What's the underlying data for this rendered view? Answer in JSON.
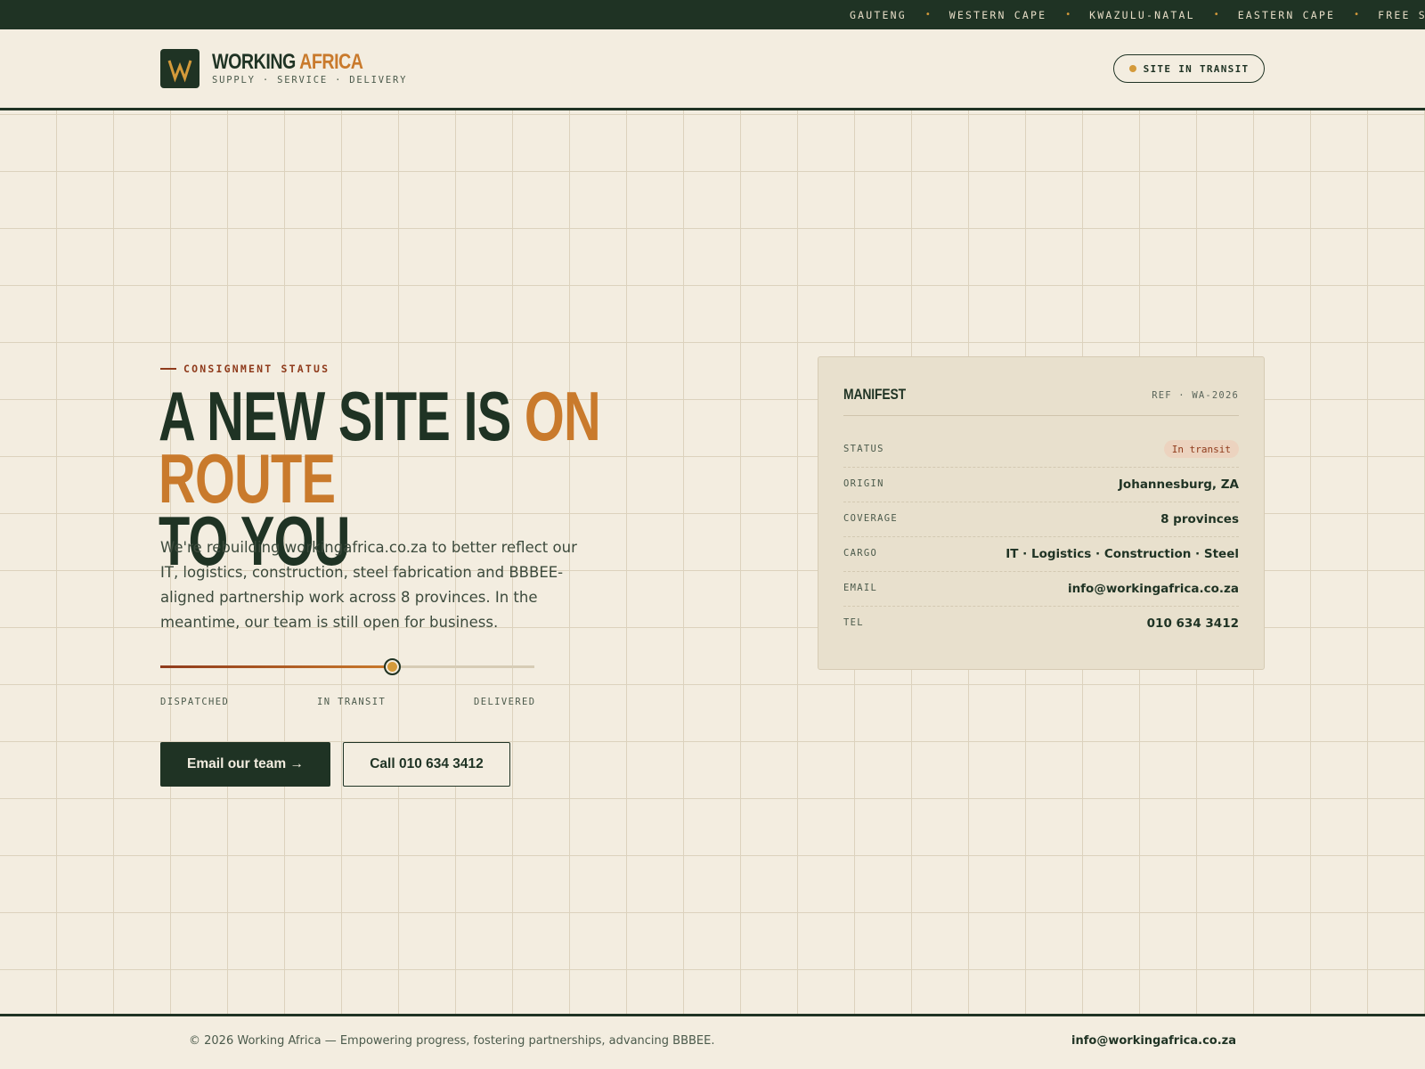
{
  "ticker": {
    "items": [
      "GAUTENG",
      "WESTERN CAPE",
      "KWAZULU-NATAL",
      "EASTERN CAPE",
      "FREE STA"
    ]
  },
  "header": {
    "logo_letter": "W",
    "brand_primary": "WORKING",
    "brand_accent": "AFRICA",
    "tagline": "SUPPLY · SERVICE · DELIVERY",
    "status_pill": "SITE IN TRANSIT"
  },
  "hero": {
    "eyebrow": "CONSIGNMENT STATUS",
    "headline_part1": "A NEW SITE IS ",
    "headline_accent": "ON ROUTE",
    "headline_part2": "TO YOU",
    "lede": "We're rebuilding workingafrica.co.za to better reflect our IT, logistics, construction, steel fabrication and BBBEE-aligned partnership work across 8 provinces. In the meantime, our team is still open for business.",
    "progress_fraction": 0.62,
    "stages": [
      "DISPATCHED",
      "IN TRANSIT",
      "DELIVERED"
    ],
    "primary_button": "Email our team →",
    "secondary_button": "Call 010 634 3412"
  },
  "manifest": {
    "title": "MANIFEST",
    "ref": "REF · WA-2026",
    "rows": [
      {
        "label": "STATUS",
        "value": "In transit"
      },
      {
        "label": "ORIGIN",
        "value": "Johannesburg, ZA"
      },
      {
        "label": "COVERAGE",
        "value": "8 provinces"
      },
      {
        "label": "CARGO",
        "value": "IT · Logistics · Construction · Steel"
      },
      {
        "label": "EMAIL",
        "value": "info@workingafrica.co.za"
      },
      {
        "label": "TEL",
        "value": "010 634 3412"
      }
    ]
  },
  "footer": {
    "copyright": "© 2026 Working Africa — Empowering progress, fostering partnerships, advancing BBBEE.",
    "email": "info@workingafrica.co.za"
  },
  "colors": {
    "forest": "#1f3324",
    "ochre": "#c97a2c",
    "rust": "#8f3b1c",
    "sand": "#f3ede0",
    "card": "#e8e0cd"
  }
}
